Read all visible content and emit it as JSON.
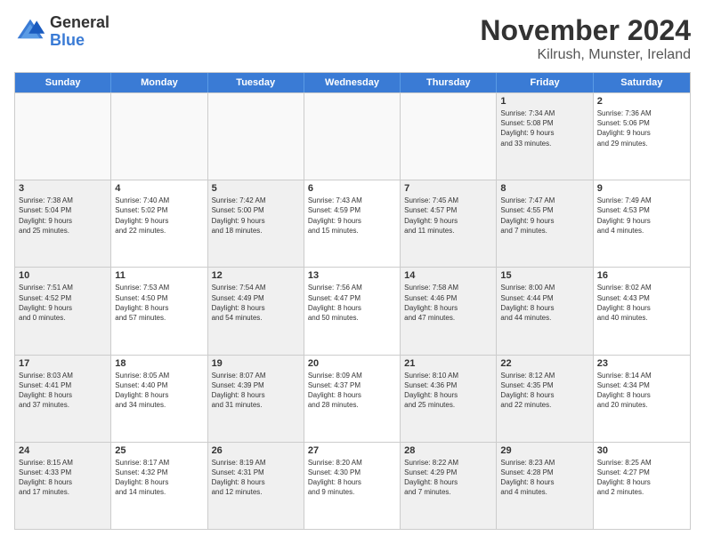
{
  "logo": {
    "general": "General",
    "blue": "Blue"
  },
  "title": "November 2024",
  "subtitle": "Kilrush, Munster, Ireland",
  "days": [
    "Sunday",
    "Monday",
    "Tuesday",
    "Wednesday",
    "Thursday",
    "Friday",
    "Saturday"
  ],
  "rows": [
    [
      {
        "num": "",
        "info": "",
        "empty": true
      },
      {
        "num": "",
        "info": "",
        "empty": true
      },
      {
        "num": "",
        "info": "",
        "empty": true
      },
      {
        "num": "",
        "info": "",
        "empty": true
      },
      {
        "num": "",
        "info": "",
        "empty": true
      },
      {
        "num": "1",
        "info": "Sunrise: 7:34 AM\nSunset: 5:08 PM\nDaylight: 9 hours\nand 33 minutes.",
        "shaded": true
      },
      {
        "num": "2",
        "info": "Sunrise: 7:36 AM\nSunset: 5:06 PM\nDaylight: 9 hours\nand 29 minutes."
      }
    ],
    [
      {
        "num": "3",
        "info": "Sunrise: 7:38 AM\nSunset: 5:04 PM\nDaylight: 9 hours\nand 25 minutes.",
        "shaded": true
      },
      {
        "num": "4",
        "info": "Sunrise: 7:40 AM\nSunset: 5:02 PM\nDaylight: 9 hours\nand 22 minutes."
      },
      {
        "num": "5",
        "info": "Sunrise: 7:42 AM\nSunset: 5:00 PM\nDaylight: 9 hours\nand 18 minutes.",
        "shaded": true
      },
      {
        "num": "6",
        "info": "Sunrise: 7:43 AM\nSunset: 4:59 PM\nDaylight: 9 hours\nand 15 minutes."
      },
      {
        "num": "7",
        "info": "Sunrise: 7:45 AM\nSunset: 4:57 PM\nDaylight: 9 hours\nand 11 minutes.",
        "shaded": true
      },
      {
        "num": "8",
        "info": "Sunrise: 7:47 AM\nSunset: 4:55 PM\nDaylight: 9 hours\nand 7 minutes.",
        "shaded": true
      },
      {
        "num": "9",
        "info": "Sunrise: 7:49 AM\nSunset: 4:53 PM\nDaylight: 9 hours\nand 4 minutes."
      }
    ],
    [
      {
        "num": "10",
        "info": "Sunrise: 7:51 AM\nSunset: 4:52 PM\nDaylight: 9 hours\nand 0 minutes.",
        "shaded": true
      },
      {
        "num": "11",
        "info": "Sunrise: 7:53 AM\nSunset: 4:50 PM\nDaylight: 8 hours\nand 57 minutes."
      },
      {
        "num": "12",
        "info": "Sunrise: 7:54 AM\nSunset: 4:49 PM\nDaylight: 8 hours\nand 54 minutes.",
        "shaded": true
      },
      {
        "num": "13",
        "info": "Sunrise: 7:56 AM\nSunset: 4:47 PM\nDaylight: 8 hours\nand 50 minutes."
      },
      {
        "num": "14",
        "info": "Sunrise: 7:58 AM\nSunset: 4:46 PM\nDaylight: 8 hours\nand 47 minutes.",
        "shaded": true
      },
      {
        "num": "15",
        "info": "Sunrise: 8:00 AM\nSunset: 4:44 PM\nDaylight: 8 hours\nand 44 minutes.",
        "shaded": true
      },
      {
        "num": "16",
        "info": "Sunrise: 8:02 AM\nSunset: 4:43 PM\nDaylight: 8 hours\nand 40 minutes."
      }
    ],
    [
      {
        "num": "17",
        "info": "Sunrise: 8:03 AM\nSunset: 4:41 PM\nDaylight: 8 hours\nand 37 minutes.",
        "shaded": true
      },
      {
        "num": "18",
        "info": "Sunrise: 8:05 AM\nSunset: 4:40 PM\nDaylight: 8 hours\nand 34 minutes."
      },
      {
        "num": "19",
        "info": "Sunrise: 8:07 AM\nSunset: 4:39 PM\nDaylight: 8 hours\nand 31 minutes.",
        "shaded": true
      },
      {
        "num": "20",
        "info": "Sunrise: 8:09 AM\nSunset: 4:37 PM\nDaylight: 8 hours\nand 28 minutes."
      },
      {
        "num": "21",
        "info": "Sunrise: 8:10 AM\nSunset: 4:36 PM\nDaylight: 8 hours\nand 25 minutes.",
        "shaded": true
      },
      {
        "num": "22",
        "info": "Sunrise: 8:12 AM\nSunset: 4:35 PM\nDaylight: 8 hours\nand 22 minutes.",
        "shaded": true
      },
      {
        "num": "23",
        "info": "Sunrise: 8:14 AM\nSunset: 4:34 PM\nDaylight: 8 hours\nand 20 minutes."
      }
    ],
    [
      {
        "num": "24",
        "info": "Sunrise: 8:15 AM\nSunset: 4:33 PM\nDaylight: 8 hours\nand 17 minutes.",
        "shaded": true
      },
      {
        "num": "25",
        "info": "Sunrise: 8:17 AM\nSunset: 4:32 PM\nDaylight: 8 hours\nand 14 minutes."
      },
      {
        "num": "26",
        "info": "Sunrise: 8:19 AM\nSunset: 4:31 PM\nDaylight: 8 hours\nand 12 minutes.",
        "shaded": true
      },
      {
        "num": "27",
        "info": "Sunrise: 8:20 AM\nSunset: 4:30 PM\nDaylight: 8 hours\nand 9 minutes."
      },
      {
        "num": "28",
        "info": "Sunrise: 8:22 AM\nSunset: 4:29 PM\nDaylight: 8 hours\nand 7 minutes.",
        "shaded": true
      },
      {
        "num": "29",
        "info": "Sunrise: 8:23 AM\nSunset: 4:28 PM\nDaylight: 8 hours\nand 4 minutes.",
        "shaded": true
      },
      {
        "num": "30",
        "info": "Sunrise: 8:25 AM\nSunset: 4:27 PM\nDaylight: 8 hours\nand 2 minutes."
      }
    ]
  ]
}
